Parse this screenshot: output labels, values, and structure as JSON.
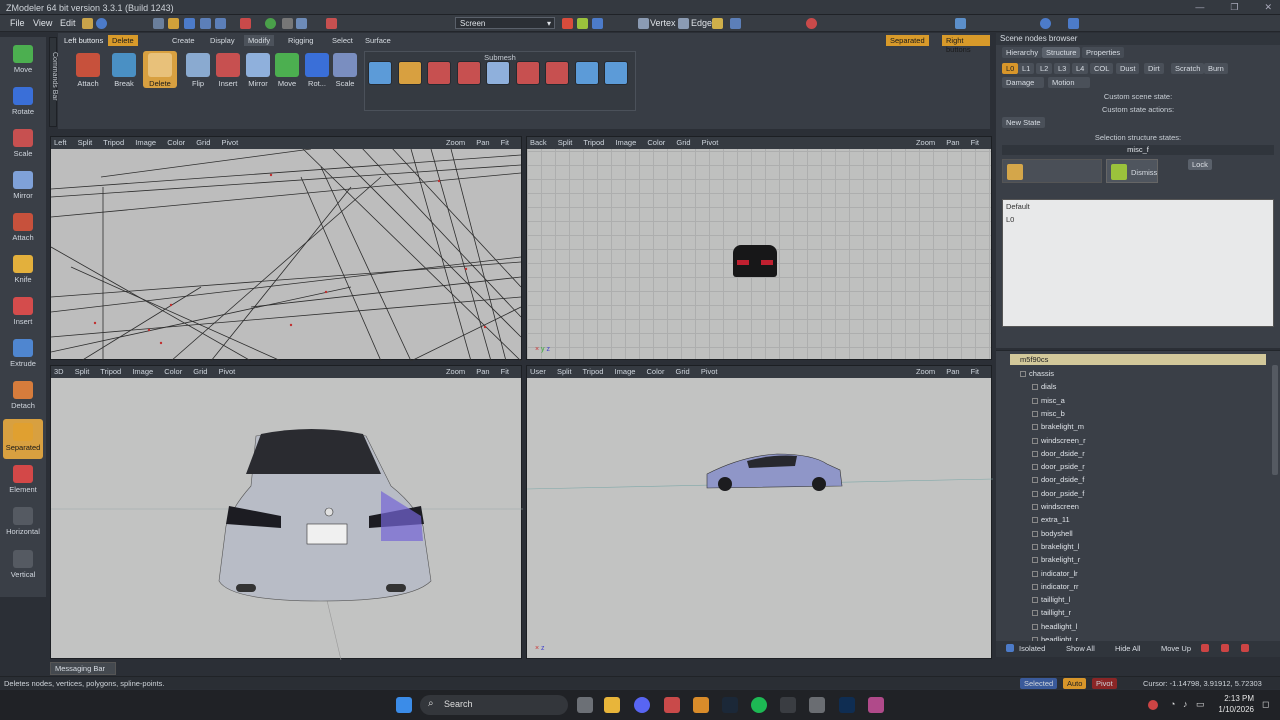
{
  "window": {
    "title": "ZModeler 64 bit version 3.3.1 (Build 1243)"
  },
  "menu": {
    "file": "File",
    "view": "View",
    "edit": "Edit",
    "screen_select": "Screen",
    "vertex": "Vertex",
    "edge": "Edge"
  },
  "left_toolbar": [
    {
      "label": "Move",
      "color": "#4caf50"
    },
    {
      "label": "Rotate",
      "color": "#3a6fd8"
    },
    {
      "label": "Scale",
      "color": "#c75050"
    },
    {
      "label": "Mirror",
      "color": "#7fa1d8"
    },
    {
      "label": "Attach",
      "color": "#c7513c"
    },
    {
      "label": "Knife",
      "color": "#e3b03c"
    },
    {
      "label": "Insert",
      "color": "#d44c4c"
    },
    {
      "label": "Extrude",
      "color": "#4f86d0"
    },
    {
      "label": "Detach",
      "color": "#d67c3c"
    },
    {
      "label": "Separated",
      "color": "#e0a030"
    },
    {
      "label": "Element",
      "color": "#d34848"
    },
    {
      "label": "Horizontal",
      "color": "#555a62"
    },
    {
      "label": "Vertical",
      "color": "#555a62"
    }
  ],
  "commands_bar": "Commands Bar",
  "ribbon": {
    "left_buttons": "Left buttons",
    "delete_tab": "Delete",
    "tabs": [
      "Create",
      "Display",
      "Modify",
      "Rigging",
      "Select",
      "Surface"
    ],
    "separated": "Separated",
    "right_buttons": "Right buttons",
    "submesh": "Submesh",
    "tools": [
      "Attach",
      "Break",
      "Delete",
      "Flip",
      "Insert",
      "Mirror",
      "Move",
      "Rot...",
      "Scale"
    ]
  },
  "viewports": [
    {
      "name": "Left",
      "menu": [
        "Split",
        "Tripod",
        "Image",
        "Color",
        "Grid",
        "Pivot"
      ],
      "zoom": "Zoom",
      "pan": "Pan",
      "fit": "Fit"
    },
    {
      "name": "Back",
      "menu": [
        "Split",
        "Tripod",
        "Image",
        "Color",
        "Grid",
        "Pivot"
      ],
      "zoom": "Zoom",
      "pan": "Pan",
      "fit": "Fit"
    },
    {
      "name": "3D",
      "menu": [
        "Split",
        "Tripod",
        "Image",
        "Color",
        "Grid",
        "Pivot"
      ],
      "zoom": "Zoom",
      "pan": "Pan",
      "fit": "Fit"
    },
    {
      "name": "User",
      "menu": [
        "Split",
        "Tripod",
        "Image",
        "Color",
        "Grid",
        "Pivot"
      ],
      "zoom": "Zoom",
      "pan": "Pan",
      "fit": "Fit"
    }
  ],
  "scene_browser": {
    "title": "Scene nodes browser",
    "tabs": [
      "Hierarchy",
      "Structure",
      "Properties"
    ],
    "lod_chips": [
      "L0",
      "L1",
      "L2",
      "L3",
      "L4",
      "COL",
      "Dust",
      "Dirt",
      "Scratch",
      "Burn"
    ],
    "damage": "Damage",
    "motion": "Motion",
    "custom_scene_state": "Custom scene state:",
    "custom_state_actions": "Custom state actions:",
    "new_state": "New State",
    "selection_states": "Selection structure states:",
    "selected_node": "misc_f",
    "dismiss": "Dismiss",
    "lock": "Lock",
    "default_label": "Default",
    "default_value": "L0"
  },
  "tree": {
    "root": "m5f90cs",
    "items": [
      "chassis",
      "dials",
      "misc_a",
      "misc_b",
      "brakelight_m",
      "windscreen_r",
      "door_dside_r",
      "door_pside_r",
      "door_dside_f",
      "door_pside_f",
      "windscreen",
      "extra_11",
      "bodyshell",
      "brakelight_l",
      "brakelight_r",
      "indicator_lr",
      "indicator_rr",
      "taillight_l",
      "taillight_r",
      "headlight_l",
      "headlight_r"
    ],
    "bottom": [
      "Isolated",
      "Show All",
      "Hide All",
      "Move Up"
    ]
  },
  "messaging_bar": "Messaging Bar",
  "status": {
    "hint": "Deletes nodes, vertices, polygons, spline-points.",
    "selected": "Selected",
    "auto": "Auto",
    "pivot": "Pivot",
    "cursor": "Cursor: -1.14798, 3.91912, 5.72303"
  },
  "taskbar": {
    "search": "Search",
    "time": "2:13 PM",
    "date": "1/10/2026"
  }
}
